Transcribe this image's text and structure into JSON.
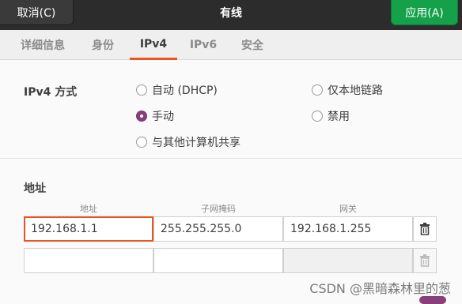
{
  "header": {
    "cancel": "取消(C)",
    "title": "有线",
    "apply": "应用(A)"
  },
  "tabs": [
    {
      "label": "详细信息"
    },
    {
      "label": "身份"
    },
    {
      "label": "IPv4"
    },
    {
      "label": "IPv6"
    },
    {
      "label": "安全"
    }
  ],
  "active_tab": "IPv4",
  "ipv4": {
    "method_label": "IPv4 方式",
    "options": [
      {
        "label": "自动 (DHCP)",
        "checked": false
      },
      {
        "label": "手动",
        "checked": true
      },
      {
        "label": "与其他计算机共享",
        "checked": false
      },
      {
        "label": "仅本地链路",
        "checked": false
      },
      {
        "label": "禁用",
        "checked": false
      }
    ]
  },
  "addresses": {
    "section_label": "地址",
    "columns": {
      "address": "地址",
      "netmask": "子网掩码",
      "gateway": "网关"
    },
    "rows": [
      {
        "address": "192.168.1.1",
        "netmask": "255.255.255.0",
        "gateway": "192.168.1.255"
      },
      {
        "address": "",
        "netmask": "",
        "gateway": ""
      }
    ]
  },
  "watermark": "CSDN @黑暗森林里的葱",
  "colors": {
    "accent": "#e95420",
    "apply": "#15a14a",
    "radio_checked": "#8a3f7a"
  },
  "icons": {
    "delete": "trash-icon"
  }
}
